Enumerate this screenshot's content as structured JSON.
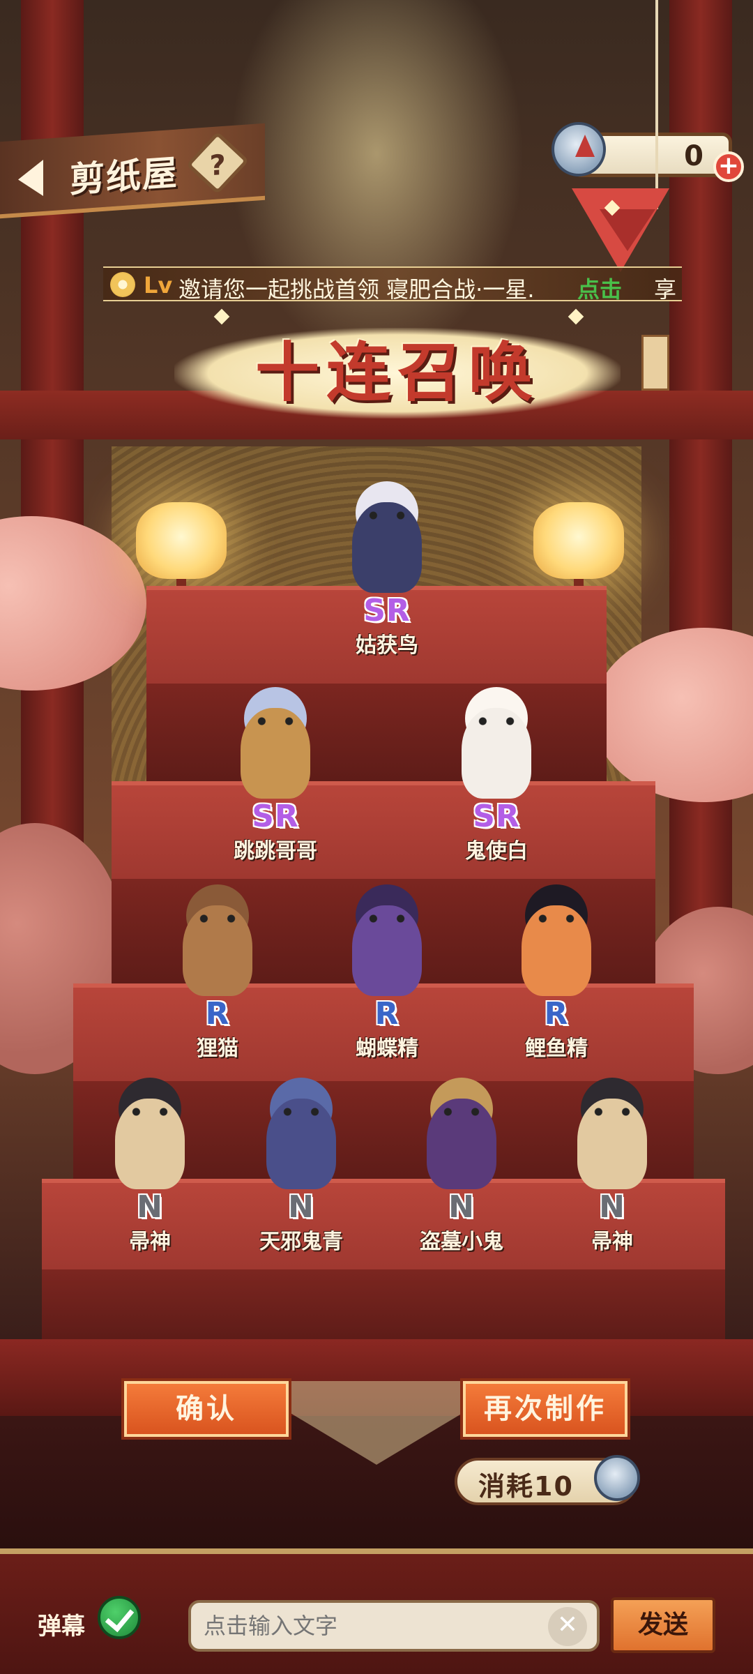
{
  "header": {
    "back_label": "剪纸屋",
    "help_icon": "?",
    "currency_value": "0",
    "currency_add": "+"
  },
  "ticker": {
    "lv": "Lv",
    "message": "邀请您一起挑战首领 寝肥合战·一星.",
    "link": "点击",
    "tail": "享"
  },
  "title": "十连召唤",
  "characters": [
    {
      "rarity": "SR",
      "name": "姑获鸟"
    },
    {
      "rarity": "SR",
      "name": "跳跳哥哥"
    },
    {
      "rarity": "SR",
      "name": "鬼使白"
    },
    {
      "rarity": "R",
      "name": "狸猫"
    },
    {
      "rarity": "R",
      "name": "蝴蝶精"
    },
    {
      "rarity": "R",
      "name": "鲤鱼精"
    },
    {
      "rarity": "N",
      "name": "帚神"
    },
    {
      "rarity": "N",
      "name": "天邪鬼青"
    },
    {
      "rarity": "N",
      "name": "盗墓小鬼"
    },
    {
      "rarity": "N",
      "name": "帚神"
    }
  ],
  "actions": {
    "confirm": "确认",
    "again": "再次制作",
    "cost_label": "消耗10"
  },
  "bottom": {
    "barrage_label": "弹幕",
    "input_placeholder": "点击输入文字",
    "clear": "✕",
    "send": "发送"
  },
  "colors": {
    "sr": "#b35ee6",
    "r": "#3a66c8",
    "n": "#6a6d74",
    "accent": "#e0722e"
  }
}
